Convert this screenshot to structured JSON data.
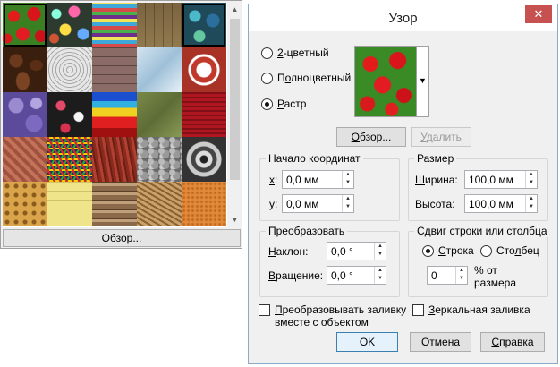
{
  "picker": {
    "browse_label": "Обзор...",
    "tiles": [
      "strawberry",
      "marbles",
      "fabric-stripes",
      "stone-wall",
      "glass-beads",
      "coffee-beans",
      "lace",
      "brick",
      "ice",
      "ornament-tile",
      "purple-flowers",
      "floral-black",
      "color-stripes",
      "green-stone",
      "red-knit",
      "woodgrain-red",
      "color-nest",
      "red-bark",
      "gravel",
      "metal-ornament",
      "cracker",
      "yellow-wood",
      "logs",
      "straw",
      "orange-sand"
    ],
    "selected_index": 0,
    "icons": {
      "up": "scroll-up-icon",
      "down": "scroll-down-icon"
    }
  },
  "dialog": {
    "title": "Узор",
    "close_glyph": "✕",
    "fill_type": {
      "two_color": {
        "u": "2",
        "rest": "-цветный"
      },
      "full_color": {
        "pre": "П",
        "u": "о",
        "rest": "лноцветный"
      },
      "bitmap": {
        "pre": "",
        "u": "Р",
        "rest": "астр"
      },
      "selected": "bitmap"
    },
    "browse_button": {
      "pre": "",
      "u": "О",
      "rest": "бзор..."
    },
    "delete_button": {
      "pre": "",
      "u": "У",
      "rest": "далить"
    },
    "origin": {
      "legend": "Начало координат",
      "x_label": {
        "u": "x",
        "rest": ":"
      },
      "x_value": "0,0 мм",
      "y_label": {
        "u": "y",
        "rest": ":"
      },
      "y_value": "0,0 мм"
    },
    "size": {
      "legend": "Размер",
      "width_label": {
        "pre": "",
        "u": "Ш",
        "rest": "ирина:"
      },
      "width_value": "100,0 мм",
      "height_label": {
        "pre": "",
        "u": "В",
        "rest": "ысота:"
      },
      "height_value": "100,0 мм"
    },
    "transform": {
      "legend": "Преобразовать",
      "skew_label": {
        "pre": "",
        "u": "Н",
        "rest": "аклон:"
      },
      "skew_value": "0,0 °",
      "rotate_label": {
        "pre": "",
        "u": "В",
        "rest": "ращение:"
      },
      "rotate_value": "0,0 °"
    },
    "offset": {
      "legend": "Сдвиг строки или столбца",
      "row": {
        "pre": "",
        "u": "С",
        "rest": "трока"
      },
      "column": {
        "pre": "Сто",
        "u": "л",
        "rest": "бец"
      },
      "selected": "row",
      "value": "0",
      "unit_line1": "% от",
      "unit_line2": "размера"
    },
    "transform_with_object": {
      "line1_pre": "",
      "line1_u": "П",
      "line1_rest": "реобразовывать заливку",
      "line2": "вместе с объектом",
      "checked": false
    },
    "mirror_fill": {
      "pre": "",
      "u": "З",
      "rest": "еркальная заливка",
      "checked": false
    },
    "ok_label": "OK",
    "cancel_label": "Отмена",
    "help_label": {
      "pre": "",
      "u": "С",
      "rest": "правка"
    }
  }
}
